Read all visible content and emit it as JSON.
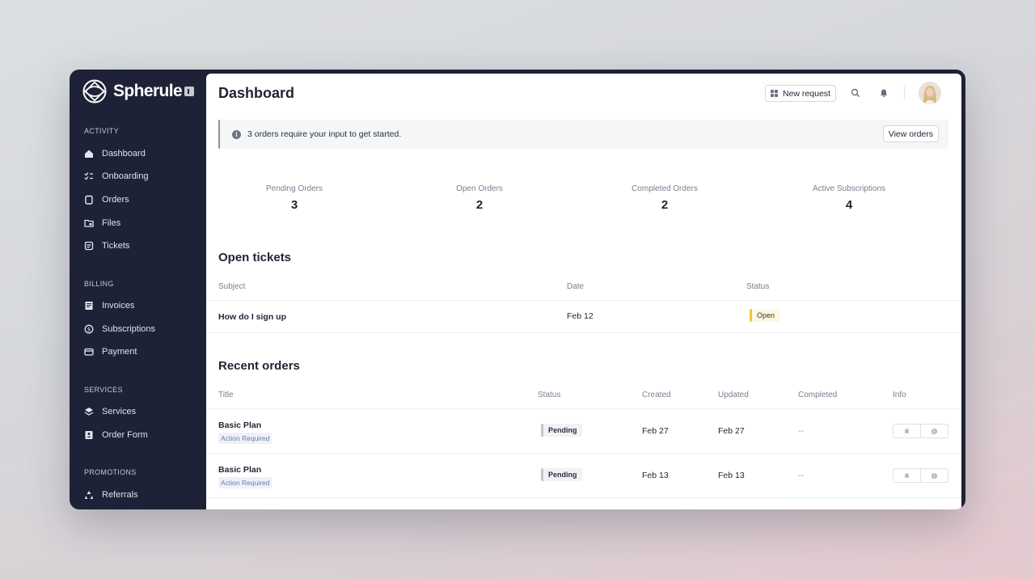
{
  "brand": {
    "name": "Spherule"
  },
  "sidebar": {
    "sections": [
      {
        "label": "ACTIVITY",
        "items": [
          {
            "label": "Dashboard",
            "icon": "home-icon"
          },
          {
            "label": "Onboarding",
            "icon": "checklist-icon"
          },
          {
            "label": "Orders",
            "icon": "clipboard-icon"
          },
          {
            "label": "Files",
            "icon": "folder-icon"
          },
          {
            "label": "Tickets",
            "icon": "ticket-icon"
          }
        ]
      },
      {
        "label": "BILLING",
        "items": [
          {
            "label": "Invoices",
            "icon": "invoice-icon"
          },
          {
            "label": "Subscriptions",
            "icon": "subscription-icon"
          },
          {
            "label": "Payment",
            "icon": "credit-card-icon"
          }
        ]
      },
      {
        "label": "SERVICES",
        "items": [
          {
            "label": "Services",
            "icon": "layers-icon"
          },
          {
            "label": "Order Form",
            "icon": "order-form-icon"
          }
        ]
      },
      {
        "label": "PROMOTIONS",
        "items": [
          {
            "label": "Referrals",
            "icon": "recycle-icon"
          }
        ]
      }
    ]
  },
  "header": {
    "title": "Dashboard",
    "new_request_label": "New request"
  },
  "notice": {
    "text": "3 orders require your input to get started.",
    "action_label": "View orders"
  },
  "stats": [
    {
      "label": "Pending Orders",
      "value": "3"
    },
    {
      "label": "Open Orders",
      "value": "2"
    },
    {
      "label": "Completed Orders",
      "value": "2"
    },
    {
      "label": "Active Subscriptions",
      "value": "4"
    }
  ],
  "open_tickets": {
    "title": "Open tickets",
    "columns": [
      "Subject",
      "Date",
      "Status"
    ],
    "rows": [
      {
        "subject": "How do I sign up",
        "date": "Feb 12",
        "status": "Open"
      }
    ]
  },
  "recent_orders": {
    "title": "Recent orders",
    "columns": [
      "Title",
      "Status",
      "Created",
      "Updated",
      "Completed",
      "Info"
    ],
    "rows": [
      {
        "title": "Basic Plan",
        "tag": "Action Required",
        "status": "Pending",
        "created": "Feb 27",
        "updated": "Feb 27",
        "completed": "--"
      },
      {
        "title": "Basic Plan",
        "tag": "Action Required",
        "status": "Pending",
        "created": "Feb 13",
        "updated": "Feb 13",
        "completed": "--"
      }
    ]
  },
  "colors": {
    "sidebar_bg": "#1e2236",
    "open_status": "#f3c53a",
    "pending_status": "#c4c7d1"
  }
}
